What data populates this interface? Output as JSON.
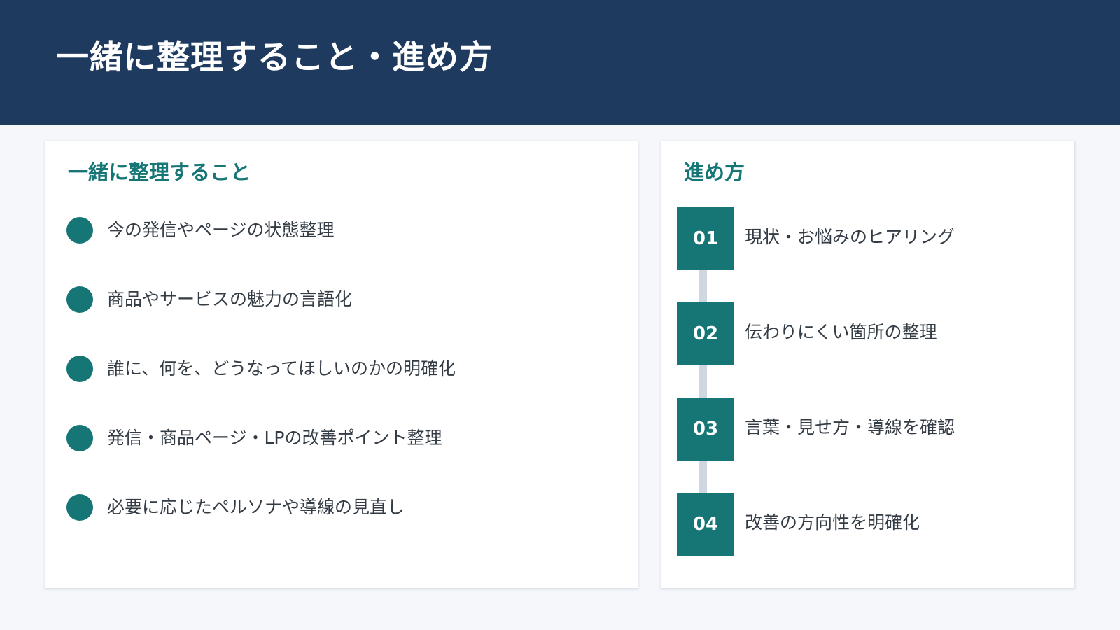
{
  "header": {
    "title": "一緒に整理すること・進め方"
  },
  "topics": {
    "title": "一緒に整理すること",
    "items": [
      "今の発信やページの状態整理",
      "商品やサービスの魅力の言語化",
      "誰に、何を、どうなってほしいのかの明確化",
      "発信・商品ページ・LPの改善ポイント整理",
      "必要に応じたペルソナや導線の見直し"
    ]
  },
  "process": {
    "title": "進め方",
    "steps": [
      {
        "number": "01",
        "label": "現状・お悩みのヒアリング"
      },
      {
        "number": "02",
        "label": "伝わりにくい箇所の整理"
      },
      {
        "number": "03",
        "label": "言葉・見せ方・導線を確認"
      },
      {
        "number": "04",
        "label": "改善の方向性を明確化"
      }
    ]
  },
  "colors": {
    "header_bg": "#1e3a5f",
    "accent": "#167676",
    "connector": "#cfd7e0",
    "page_bg": "#f5f7fb"
  }
}
